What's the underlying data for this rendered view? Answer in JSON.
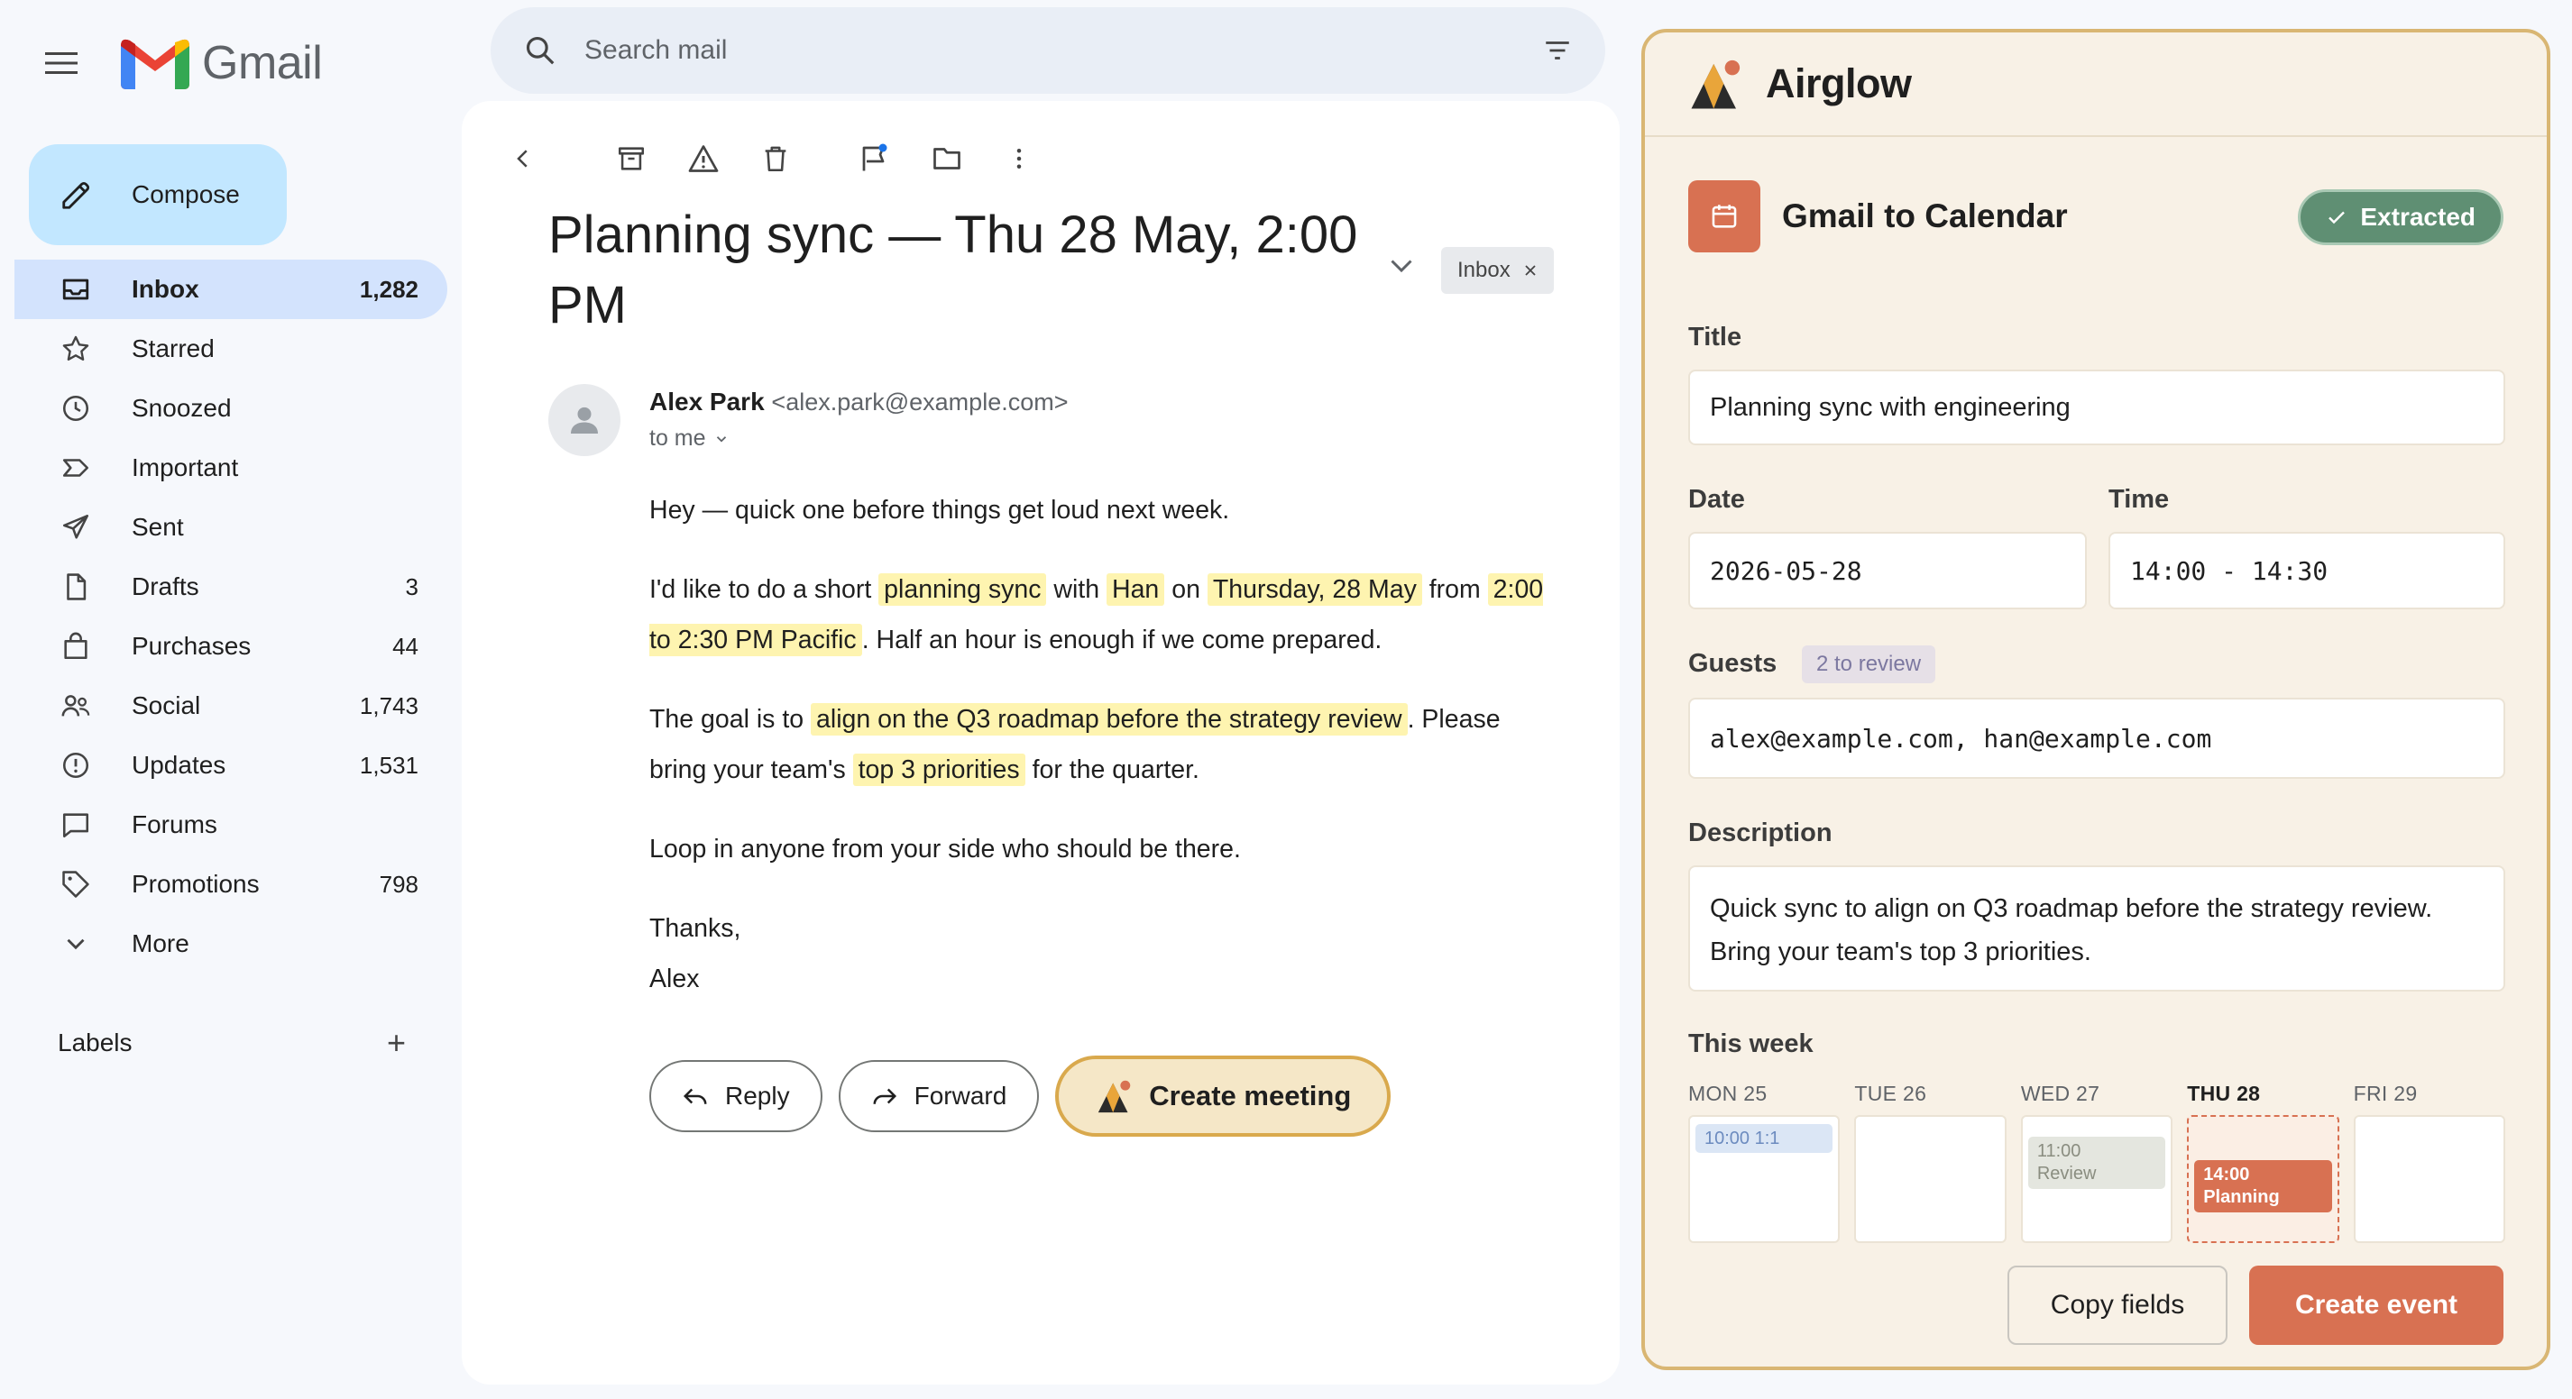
{
  "app": {
    "name": "Gmail"
  },
  "compose": {
    "label": "Compose"
  },
  "nav": [
    {
      "label": "Inbox",
      "count": "1,282",
      "icon": "inbox-icon"
    },
    {
      "label": "Starred",
      "count": "",
      "icon": "star-icon"
    },
    {
      "label": "Snoozed",
      "count": "",
      "icon": "clock-icon"
    },
    {
      "label": "Important",
      "count": "",
      "icon": "important-icon"
    },
    {
      "label": "Sent",
      "count": "",
      "icon": "send-icon"
    },
    {
      "label": "Drafts",
      "count": "3",
      "icon": "file-icon"
    },
    {
      "label": "Purchases",
      "count": "44",
      "icon": "bag-icon"
    },
    {
      "label": "Social",
      "count": "1,743",
      "icon": "people-icon"
    },
    {
      "label": "Updates",
      "count": "1,531",
      "icon": "info-icon"
    },
    {
      "label": "Forums",
      "count": "",
      "icon": "chat-icon"
    },
    {
      "label": "Promotions",
      "count": "798",
      "icon": "tag-icon"
    },
    {
      "label": "More",
      "count": "",
      "icon": "chevron-down-icon"
    }
  ],
  "labels": {
    "title": "Labels",
    "add": "+"
  },
  "search": {
    "placeholder": "Search mail"
  },
  "email": {
    "subject": "Planning sync — Thu 28 May, 2:00 PM",
    "chip": "Inbox",
    "sender_name": "Alex Park",
    "sender_email": "<alex.park@example.com>",
    "to": "to me",
    "p1": "Hey — quick one before things get loud next week.",
    "p2": {
      "a": "I'd like to do a short",
      "h1": "planning sync",
      "b": "with",
      "h2": "Han",
      "c": "on",
      "h3": "Thursday, 28 May",
      "d": "from",
      "h4": "2:00 to 2:30 PM Pacific",
      "e": ". Half an hour is enough if we come prepared."
    },
    "p3": {
      "a": "The goal is to",
      "h1": "align on the Q3 roadmap before the strategy review",
      "b": ". Please bring your team's",
      "h2": "top 3 priorities",
      "c": "for the quarter."
    },
    "p4": "Loop in anyone from your side who should be there.",
    "sign1": "Thanks,",
    "sign2": "Alex",
    "reply": "Reply",
    "forward": "Forward",
    "create_meeting": "Create meeting"
  },
  "airglow": {
    "brand": "Airglow",
    "card_title": "Gmail to Calendar",
    "status": "Extracted",
    "title_label": "Title",
    "title_value": "Planning sync with engineering",
    "date_label": "Date",
    "date_value": "2026-05-28",
    "time_label": "Time",
    "time_value": "14:00 - 14:30",
    "guests_label": "Guests",
    "guests_chip": "2 to review",
    "guests_value": "alex@example.com, han@example.com",
    "desc_label": "Description",
    "desc_value": "Quick sync to align on Q3 roadmap before the strategy review. Bring your team's top 3 priorities.",
    "week_label": "This week",
    "days": [
      {
        "name": "MON 25",
        "event": "10:00 1:1"
      },
      {
        "name": "TUE 26",
        "event": ""
      },
      {
        "name": "WED 27",
        "event_time": "11:00",
        "event_name": "Review"
      },
      {
        "name": "THU 28",
        "event_time": "14:00",
        "event_name": "Planning"
      },
      {
        "name": "FRI 29",
        "event": ""
      }
    ],
    "copy_fields": "Copy fields",
    "create_event": "Create event"
  },
  "colors": {
    "accent": "#d87152",
    "inbox_active": "#d3e3fd",
    "compose": "#c2e7ff",
    "highlight": "#fef4b0",
    "extracted": "#5f8f73"
  }
}
